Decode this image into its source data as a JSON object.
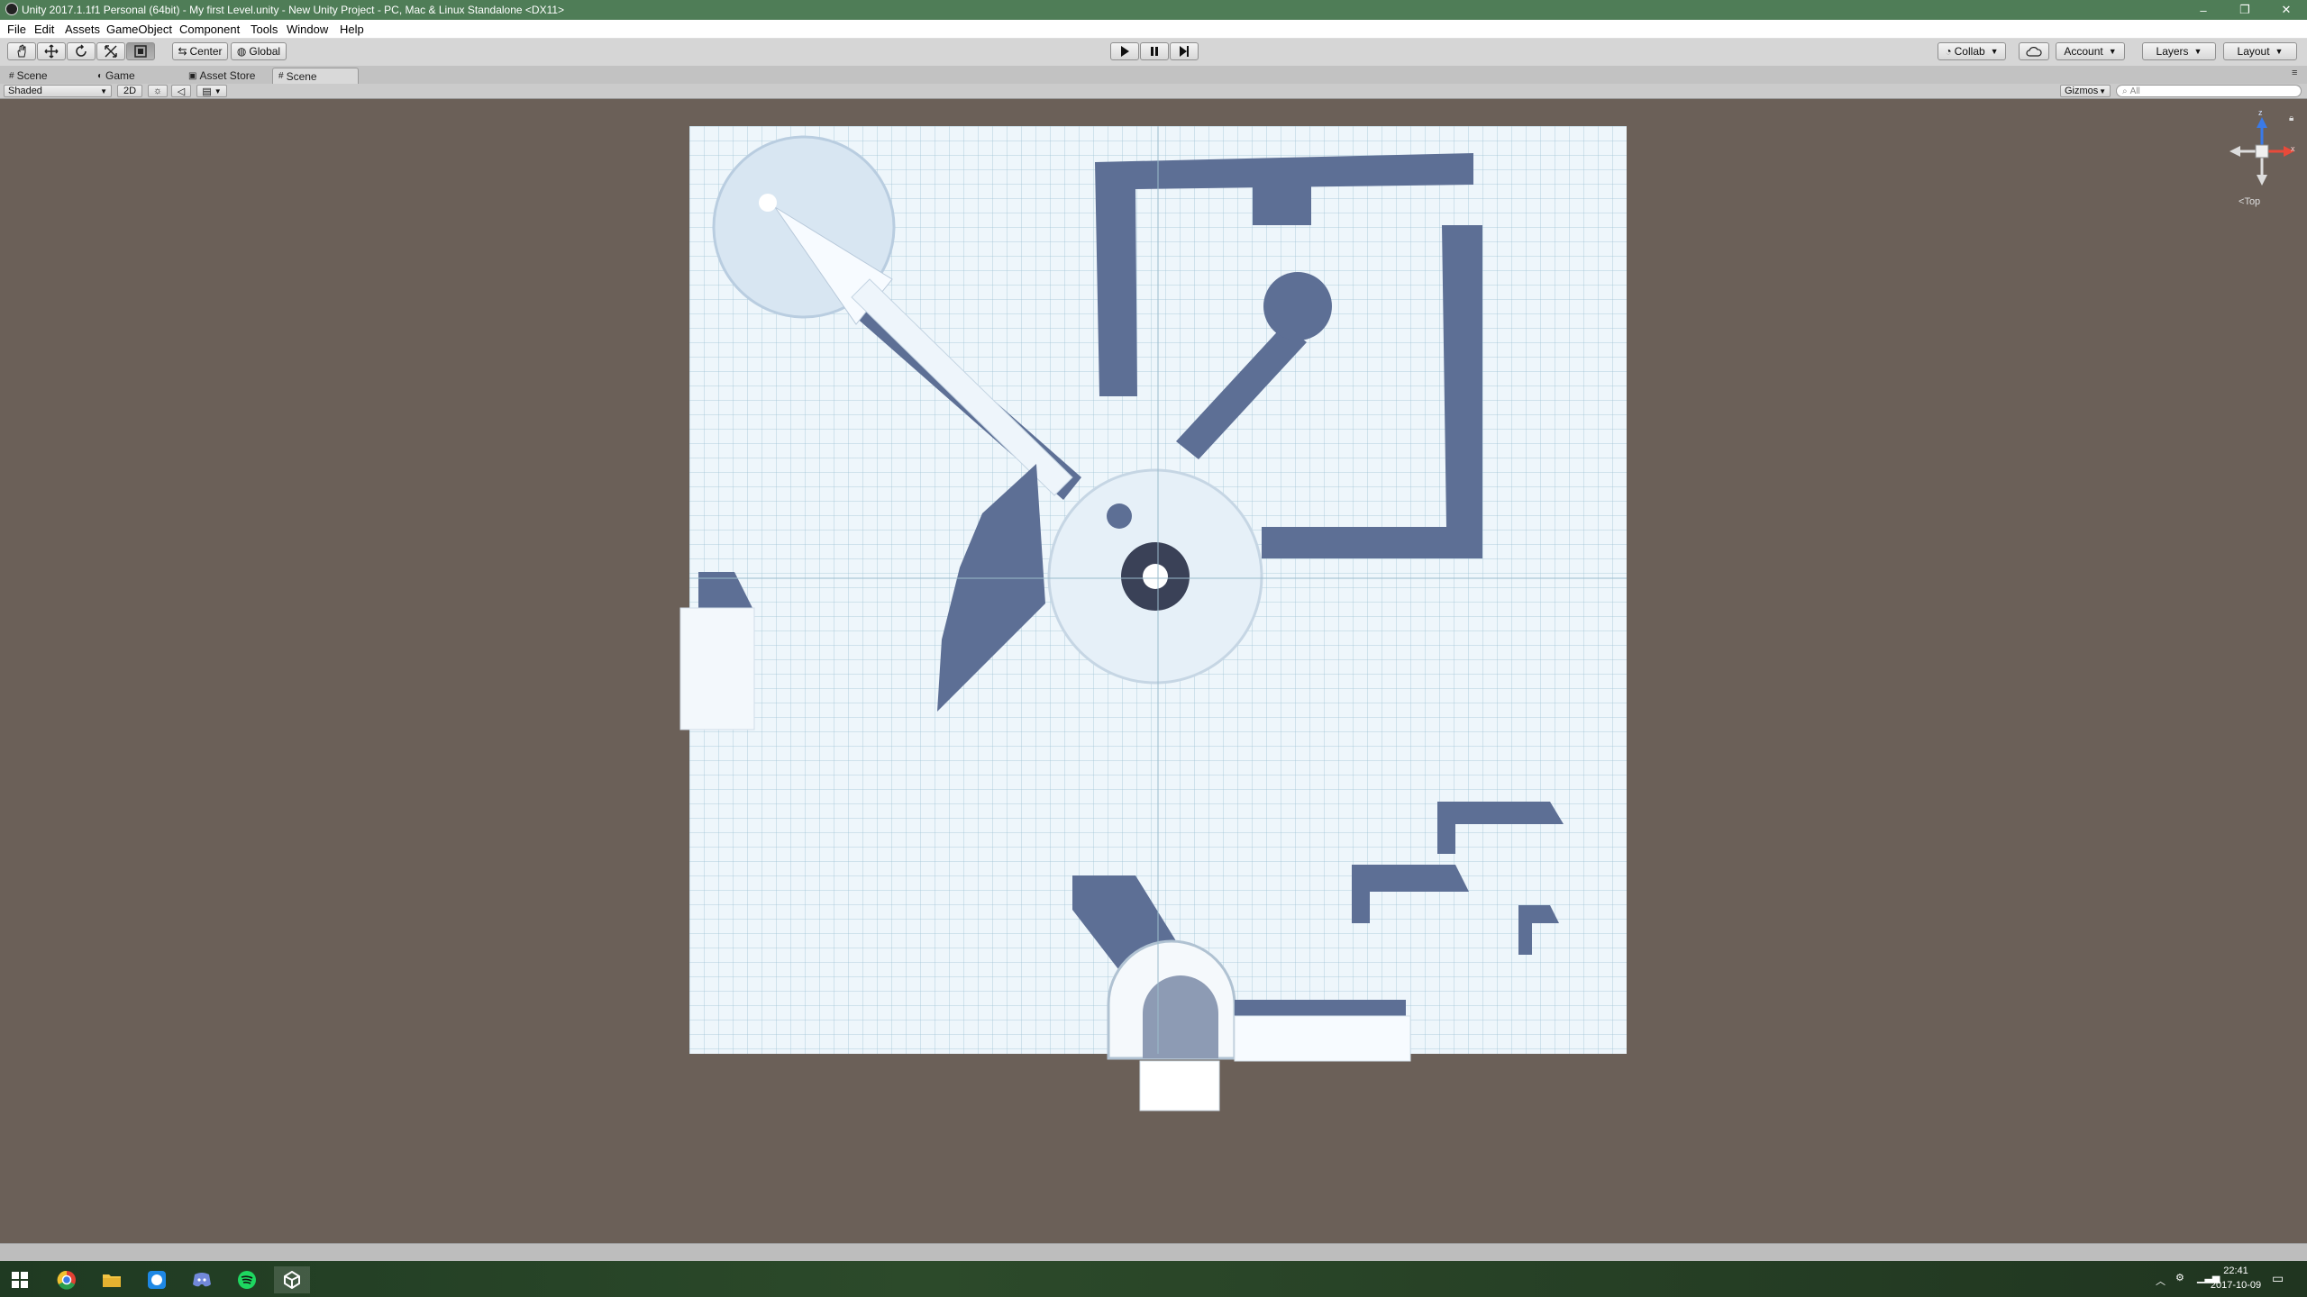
{
  "window": {
    "title": "Unity 2017.1.1f1 Personal (64bit) - My first Level.unity - New Unity Project - PC, Mac & Linux Standalone <DX11>",
    "minimize_glyph": "–",
    "restore_glyph": "❐",
    "close_glyph": "✕"
  },
  "menu": [
    "File",
    "Edit",
    "Assets",
    "GameObject",
    "Component",
    "Tools",
    "Window",
    "Help"
  ],
  "toolbar": {
    "pivot_mode": "Center",
    "pivot_rotation": "Global",
    "collab": "Collab",
    "account": "Account",
    "layers": "Layers",
    "layout": "Layout",
    "tools": [
      "hand-tool",
      "move-tool",
      "rotate-tool",
      "scale-tool",
      "rect-tool"
    ],
    "active_tool": "rect-tool"
  },
  "tabs": [
    {
      "label": "Scene",
      "icon": "scene-icon",
      "active": false
    },
    {
      "label": "Game",
      "icon": "game-icon",
      "active": false
    },
    {
      "label": "Asset Store",
      "icon": "store-icon",
      "active": false
    },
    {
      "label": "Scene",
      "icon": "scene-icon",
      "active": true
    }
  ],
  "scene_controls": {
    "draw_mode": "Shaded",
    "mode_2d": "2D",
    "gizmos": "Gizmos",
    "search_placeholder": "All"
  },
  "gizmo": {
    "view_label": "Top",
    "x_label": "x",
    "z_label": "z",
    "colors": {
      "x": "#e84a3a",
      "z": "#3a7ae8"
    }
  },
  "taskbar": {
    "apps": [
      "windows-start-icon",
      "chrome-icon",
      "file-explorer-icon",
      "messenger-icon",
      "discord-icon",
      "spotify-icon",
      "unity-icon"
    ],
    "time": "22:41",
    "date": "2017-10-09"
  },
  "colors": {
    "titlebar": "#4f7d57",
    "viewport_bg": "#6b6058",
    "scene_floor": "#eef6fb",
    "shadow": "#5d6f95"
  }
}
